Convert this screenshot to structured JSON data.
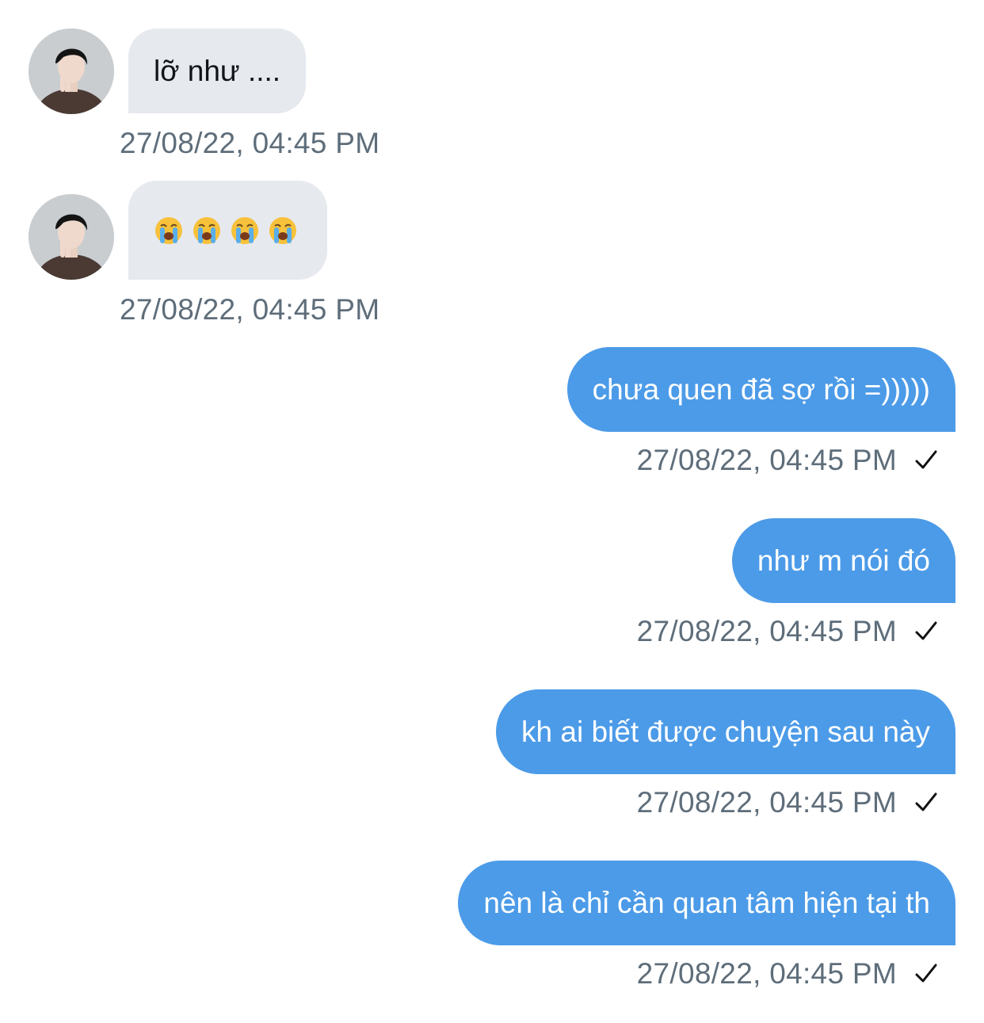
{
  "messages": [
    {
      "direction": "incoming",
      "text": "lỡ như ....",
      "timestamp": "27/08/22, 04:45 PM"
    },
    {
      "direction": "incoming",
      "text": "😭😭😭😭",
      "timestamp": "27/08/22, 04:45 PM"
    },
    {
      "direction": "outgoing",
      "text": "chưa quen đã sợ rồi =)))))",
      "timestamp": "27/08/22, 04:45 PM",
      "status_icon": "check-icon"
    },
    {
      "direction": "outgoing",
      "text": "như m nói đó",
      "timestamp": "27/08/22, 04:45 PM",
      "status_icon": "check-icon"
    },
    {
      "direction": "outgoing",
      "text": "kh ai biết được chuyện sau này",
      "timestamp": "27/08/22, 04:45 PM",
      "status_icon": "check-icon"
    },
    {
      "direction": "outgoing",
      "text": "nên là chỉ cần quan tâm hiện tại th",
      "timestamp": "27/08/22, 04:45 PM",
      "status_icon": "check-icon"
    }
  ],
  "colors": {
    "outgoing_bubble": "#4c9be8",
    "incoming_bubble": "#e6e9ee",
    "timestamp_text": "#5e6d7a",
    "background": "#ffffff"
  }
}
